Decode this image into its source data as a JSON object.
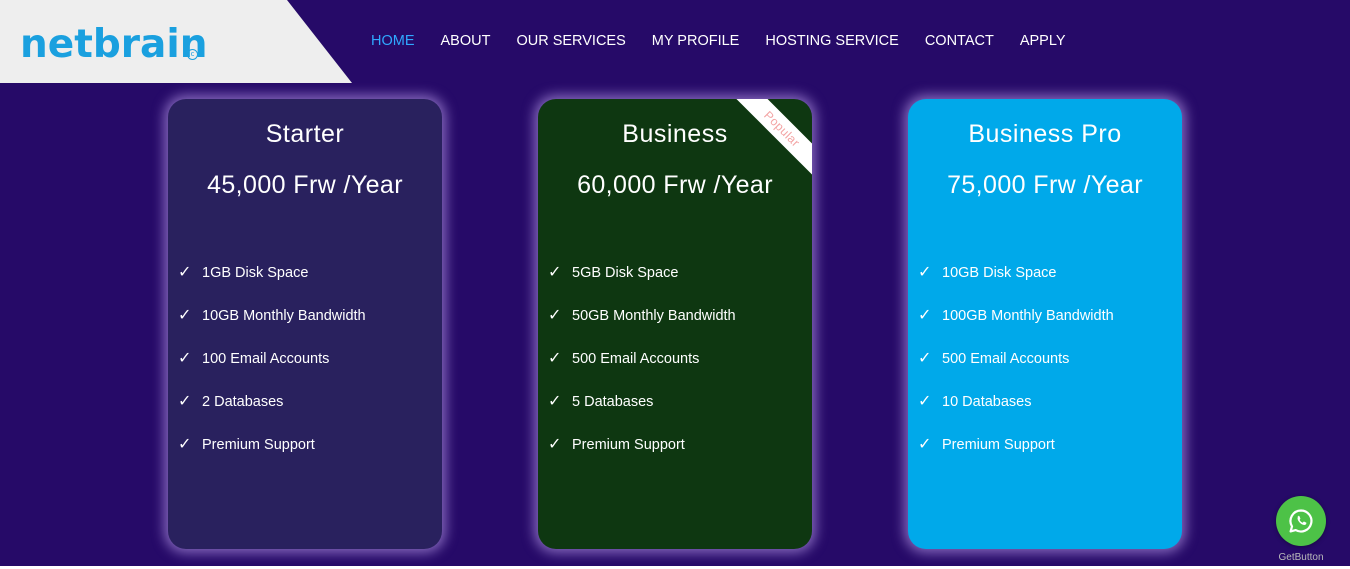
{
  "logo": {
    "text": "netbrain",
    "copyright": "c"
  },
  "nav": {
    "items": [
      {
        "label": "HOME"
      },
      {
        "label": "ABOUT"
      },
      {
        "label": "OUR SERVICES"
      },
      {
        "label": "MY PROFILE"
      },
      {
        "label": "HOSTING SERVICE"
      },
      {
        "label": "CONTACT"
      },
      {
        "label": "APPLY"
      }
    ],
    "active": "HOME"
  },
  "plans": [
    {
      "title": "Starter",
      "price": "45,000 Frw /Year",
      "features": [
        "1GB Disk Space",
        "10GB Monthly Bandwidth",
        "100 Email Accounts",
        "2 Databases",
        "Premium Support"
      ]
    },
    {
      "title": "Business",
      "price": "60,000 Frw /Year",
      "ribbon": "Popular",
      "features": [
        "5GB Disk Space",
        "50GB Monthly Bandwidth",
        "500 Email Accounts",
        "5 Databases",
        "Premium Support"
      ]
    },
    {
      "title": "Business Pro",
      "price": "75,000 Frw /Year",
      "features": [
        "10GB Disk Space",
        "100GB Monthly Bandwidth",
        "500 Email Accounts",
        "10 Databases",
        "Premium Support"
      ]
    }
  ],
  "check_mark": "✓",
  "whatsapp": {
    "icon": "whatsapp-icon",
    "label": "GetButton"
  },
  "colors": {
    "background": "#260a68",
    "starter_card": "#29215e",
    "business_card": "#0e3711",
    "pro_card": "#00a9ea",
    "nav_active": "#2fa8ff",
    "logo": "#1aa0df",
    "whatsapp": "#4dc247"
  }
}
